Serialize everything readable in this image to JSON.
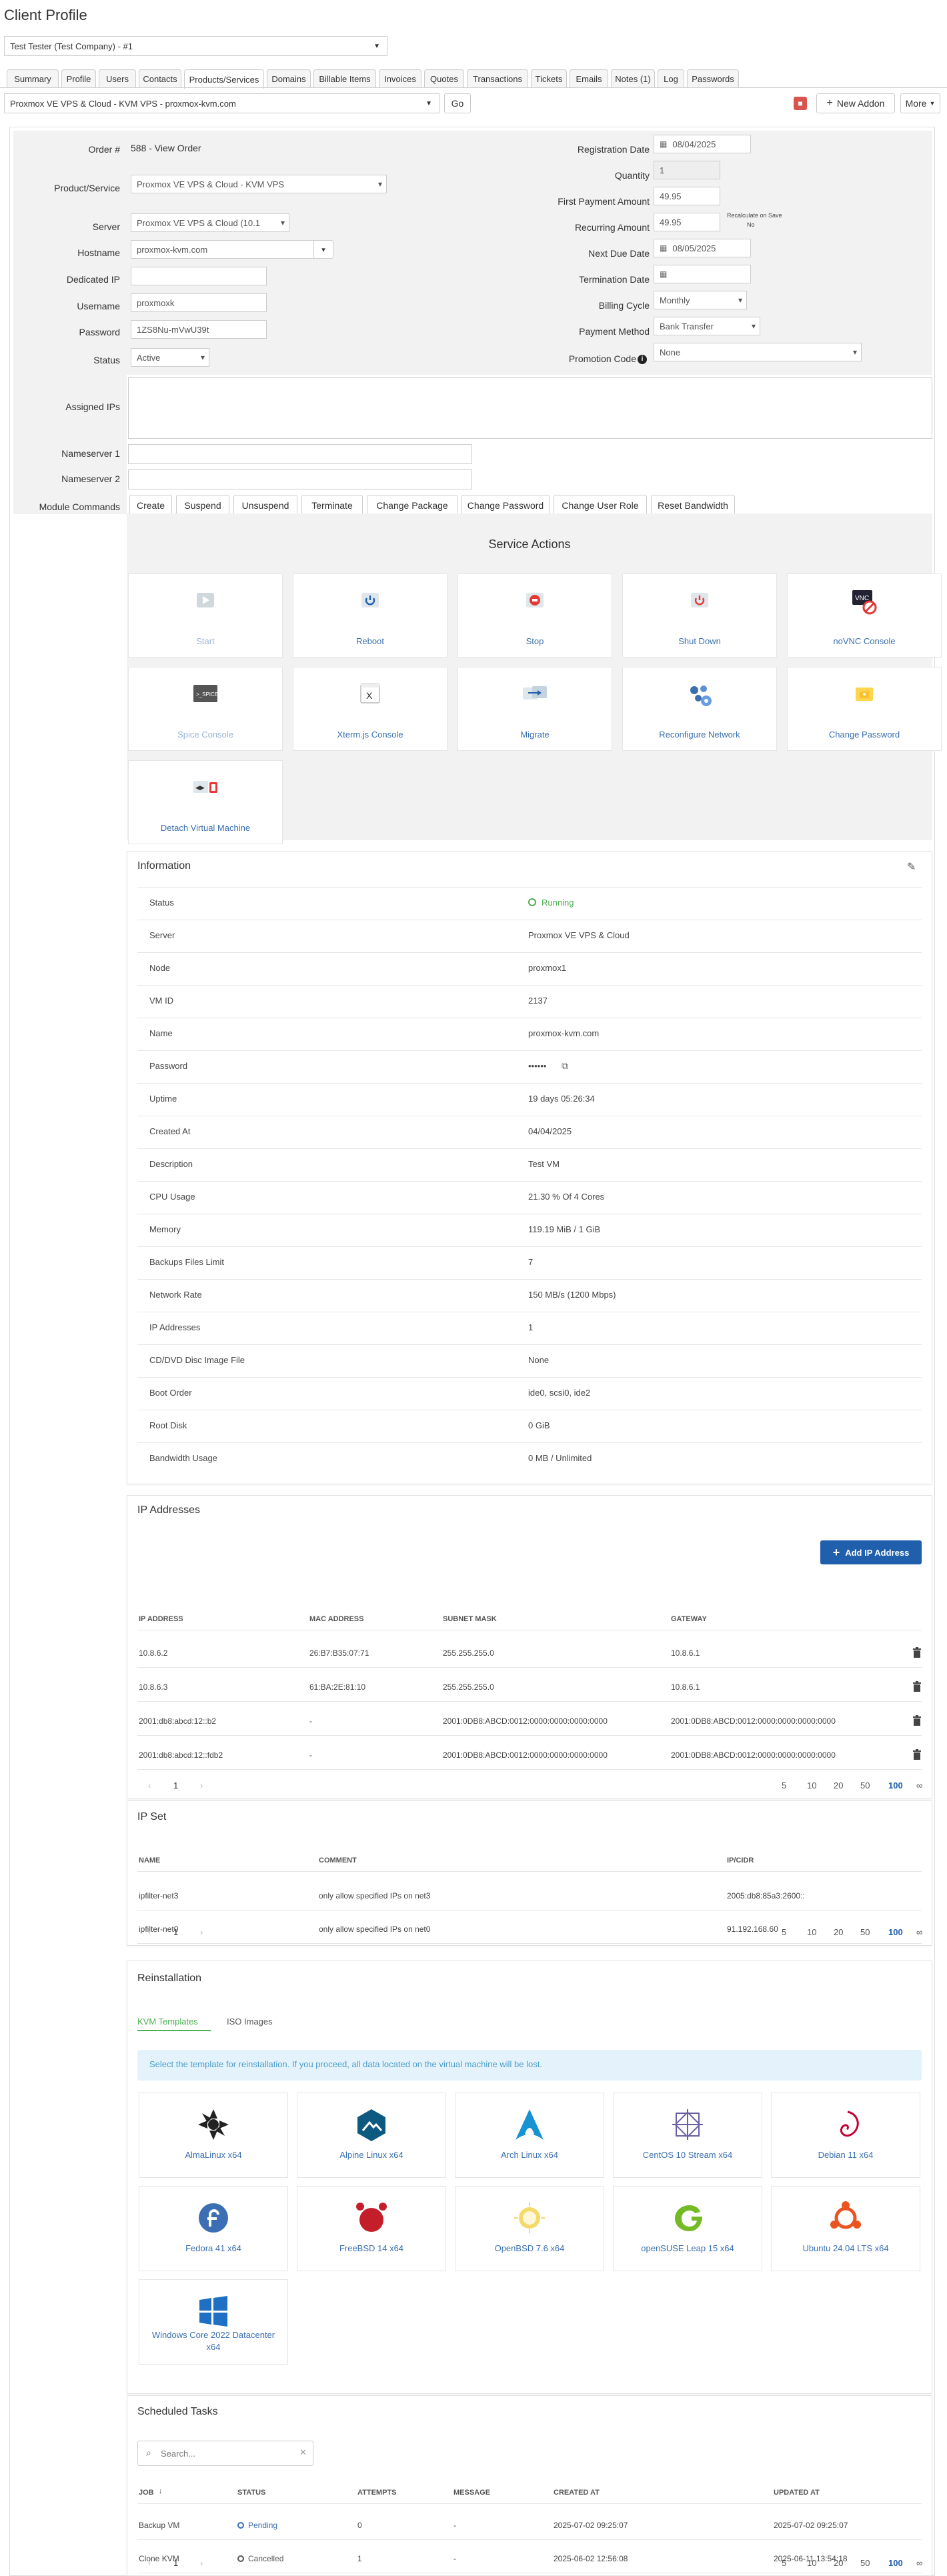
{
  "page": {
    "title": "Client Profile"
  },
  "client_select": {
    "value": "Test Tester (Test Company) - #1"
  },
  "tabs": [
    "Summary",
    "Profile",
    "Users",
    "Contacts",
    "Products/Services",
    "Domains",
    "Billable Items",
    "Invoices",
    "Quotes",
    "Transactions",
    "Tickets",
    "Emails",
    "Notes (1)",
    "Log",
    "Passwords"
  ],
  "service_select": {
    "value": "Proxmox VE VPS & Cloud - KVM VPS - proxmox-kvm.com"
  },
  "toolbar": {
    "go": "Go",
    "new_addon": "New Addon",
    "more": "More"
  },
  "form": {
    "order_label": "Order #",
    "order_value": "588 - View Order",
    "product_label": "Product/Service",
    "product_value": "Proxmox VE VPS & Cloud - KVM VPS",
    "server_label": "Server",
    "server_value": "Proxmox VE VPS & Cloud (10.1",
    "hostname_label": "Hostname",
    "hostname_value": "proxmox-kvm.com",
    "dedicated_ip_label": "Dedicated IP",
    "username_label": "Username",
    "username_value": "proxmoxk",
    "password_label": "Password",
    "password_value": "1ZS8Nu-mVwU39t",
    "status_label": "Status",
    "status_value": "Active",
    "reg_date_label": "Registration Date",
    "reg_date_value": "08/04/2025",
    "quantity_label": "Quantity",
    "quantity_value": "1",
    "first_payment_label": "First Payment Amount",
    "first_payment_value": "49.95",
    "recurring_label": "Recurring Amount",
    "recurring_value": "49.95",
    "recalc_label": "Recalculate on Save",
    "recalc_no": "No",
    "next_due_label": "Next Due Date",
    "next_due_value": "08/05/2025",
    "termination_label": "Termination Date",
    "billing_cycle_label": "Billing Cycle",
    "billing_cycle_value": "Monthly",
    "payment_method_label": "Payment Method",
    "payment_method_value": "Bank Transfer",
    "promo_label": "Promotion Code",
    "promo_value": "None",
    "assigned_ips_label": "Assigned IPs",
    "ns1_label": "Nameserver 1",
    "ns2_label": "Nameserver 2",
    "module_label": "Module Commands",
    "module_buttons": [
      "Create",
      "Suspend",
      "Unsuspend",
      "Terminate",
      "Change Package",
      "Change Password",
      "Change User Role",
      "Reset Bandwidth"
    ]
  },
  "service_actions": {
    "title": "Service Actions",
    "items": [
      "Start",
      "Reboot",
      "Stop",
      "Shut Down",
      "noVNC Console",
      "Spice Console",
      "Xterm.js Console",
      "Migrate",
      "Reconfigure Network",
      "Change Password",
      "Detach Virtual Machine"
    ]
  },
  "information": {
    "title": "Information",
    "rows": [
      {
        "k": "Status",
        "v": "Running"
      },
      {
        "k": "Server",
        "v": "Proxmox VE VPS & Cloud"
      },
      {
        "k": "Node",
        "v": "proxmox1"
      },
      {
        "k": "VM ID",
        "v": "2137"
      },
      {
        "k": "Name",
        "v": "proxmox-kvm.com"
      },
      {
        "k": "Password",
        "v": "••••••"
      },
      {
        "k": "Uptime",
        "v": "19 days 05:26:34"
      },
      {
        "k": "Created At",
        "v": "04/04/2025"
      },
      {
        "k": "Description",
        "v": "Test VM"
      },
      {
        "k": "CPU Usage",
        "v": "21.30 % Of 4 Cores"
      },
      {
        "k": "Memory",
        "v": "119.19 MiB / 1 GiB"
      },
      {
        "k": "Backups Files Limit",
        "v": "7"
      },
      {
        "k": "Network Rate",
        "v": "150 MB/s (1200 Mbps)"
      },
      {
        "k": "IP Addresses",
        "v": "1"
      },
      {
        "k": "CD/DVD Disc Image File",
        "v": "None"
      },
      {
        "k": "Boot Order",
        "v": "ide0, scsi0, ide2"
      },
      {
        "k": "Root Disk",
        "v": "0 GiB"
      },
      {
        "k": "Bandwidth Usage",
        "v": "0 MB / Unlimited"
      }
    ]
  },
  "ip_addresses": {
    "title": "IP Addresses",
    "add_button": "Add IP Address",
    "headers": [
      "IP ADDRESS",
      "MAC ADDRESS",
      "SUBNET MASK",
      "GATEWAY"
    ],
    "rows": [
      [
        "10.8.6.2",
        "26:B7:B35:07:71",
        "255.255.255.0",
        "10.8.6.1"
      ],
      [
        "10.8.6.3",
        "61:BA:2E:81:10",
        "255.255.255.0",
        "10.8.6.1"
      ],
      [
        "2001:db8:abcd:12::b2",
        "-",
        "2001:0DB8:ABCD:0012:0000:0000:0000:0000",
        "2001:0DB8:ABCD:0012:0000:0000:0000:0000"
      ],
      [
        "2001:db8:abcd:12::fdb2",
        "-",
        "2001:0DB8:ABCD:0012:0000:0000:0000:0000",
        "2001:0DB8:ABCD:0012:0000:0000:0000:0000"
      ]
    ]
  },
  "pagination": {
    "page": "1",
    "sizes": [
      "5",
      "10",
      "20",
      "50",
      "100",
      "∞"
    ]
  },
  "ip_set": {
    "title": "IP Set",
    "headers": [
      "NAME",
      "COMMENT",
      "IP/CIDR"
    ],
    "rows": [
      [
        "ipfilter-net3",
        "only allow specified IPs on net3",
        "2005:db8:85a3:2600::"
      ],
      [
        "ipfilter-net0",
        "only allow specified IPs on net0",
        "91.192.168.60"
      ]
    ]
  },
  "reinstall": {
    "title": "Reinstallation",
    "tab_kvm": "KVM Templates",
    "tab_iso": "ISO Images",
    "notice": "Select the template for reinstallation. If you proceed, all data located on the virtual machine will be lost.",
    "os": [
      "AlmaLinux x64",
      "Alpine Linux x64",
      "Arch Linux x64",
      "CentOS 10 Stream x64",
      "Debian 11 x64",
      "Fedora 41 x64",
      "FreeBSD 14 x64",
      "OpenBSD 7.6 x64",
      "openSUSE Leap 15 x64",
      "Ubuntu 24.04 LTS x64",
      "Windows Core 2022 Datacenter x64"
    ]
  },
  "tasks": {
    "title": "Scheduled Tasks",
    "search_placeholder": "Search...",
    "headers": [
      "JOB",
      "STATUS",
      "ATTEMPTS",
      "MESSAGE",
      "CREATED AT",
      "UPDATED AT"
    ],
    "rows": [
      [
        "Backup VM",
        "Pending",
        "0",
        "-",
        "2025-07-02 09:25:07",
        "2025-07-02 09:25:07"
      ],
      [
        "Clone KVM",
        "Cancelled",
        "1",
        "-",
        "2025-06-02 12:56:08",
        "2025-06-11 13:54:18"
      ]
    ]
  },
  "colors": {
    "accent": "#1f5fab",
    "running": "#4caf50",
    "link": "#3a6fb0"
  }
}
